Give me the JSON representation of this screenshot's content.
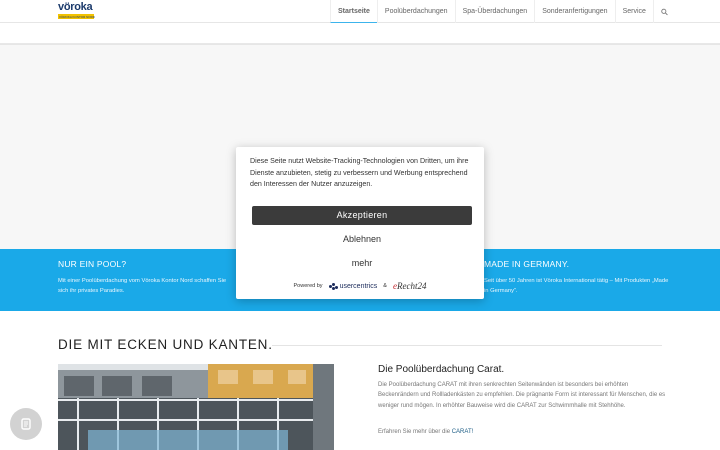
{
  "header": {
    "logo_text": "vöroka",
    "logo_sub": "VÖROKA KONTOR NORD",
    "nav": [
      {
        "label": "Startseite",
        "active": true
      },
      {
        "label": "Poolüberdachungen",
        "active": false
      },
      {
        "label": "Spa-Überdachungen",
        "active": false
      },
      {
        "label": "Sonderanfertigungen",
        "active": false
      },
      {
        "label": "Service",
        "active": false
      }
    ],
    "search_icon": "search-icon"
  },
  "band": {
    "col1": {
      "title": "NUR EIN POOL?",
      "text": "Mit einer Poolüberdachung vom Vöroka Kontor Nord schaffen Sie sich ihr privates Paradies."
    },
    "col3": {
      "title": "MADE IN GERMANY.",
      "text": "Seit über 50 Jahren ist Vöroka International tätig – Mit Produkten „Made in Germany“."
    }
  },
  "section": {
    "title": "DIE MIT ECKEN UND KANTEN.",
    "product_title": "Die Poolüberdachung Carat.",
    "product_text": "Die Poolüberdachung CARAT mit ihren senkrechten Seitenwänden ist besonders bei erhöhten Beckenrändern und Rollladenkästen zu empfehlen. Die prägnante Form ist interessant für Menschen, die es weniger rund mögen. In erhöhter Bauweise wird die CARAT zur Schwimmhalle mit Stehhöhe.",
    "more_prefix": "Erfahren Sie mehr über die ",
    "more_link": "CARAT!"
  },
  "consent": {
    "text": "Diese Seite nutzt Website-Tracking-Technologien von Dritten, um ihre Dienste anzubieten, stetig zu verbessern und Werbung entsprechend den Interessen der Nutzer anzuzeigen.",
    "accept_label": "Akzeptieren",
    "deny_label": "Ablehnen",
    "more_label": "mehr",
    "powered_by": "Powered by",
    "usercentrics": "usercentrics",
    "amp": "&",
    "erecht_prefix": "e",
    "erecht_name": "Recht24"
  },
  "colors": {
    "band": "#1aa9e8",
    "accept_button": "#3b3b3b",
    "nav_active_underline": "#3cb4ec"
  }
}
